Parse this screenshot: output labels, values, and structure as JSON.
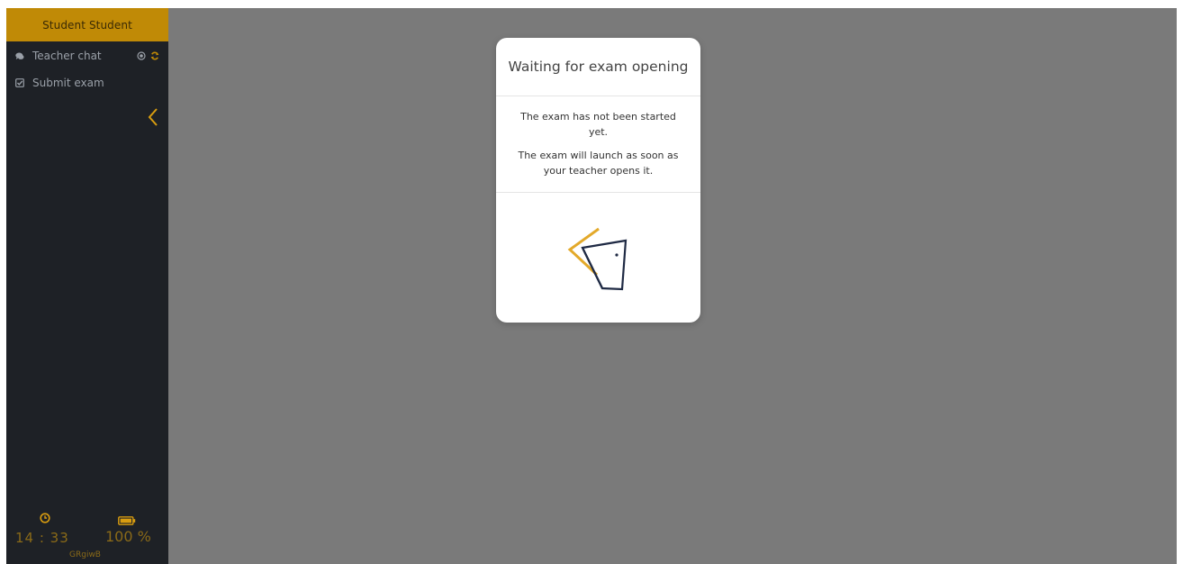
{
  "sidebar": {
    "user_name": "Student Student",
    "items": [
      {
        "label": "Teacher chat",
        "icon": "chat-icon"
      },
      {
        "label": "Submit exam",
        "icon": "checkbox-icon"
      }
    ],
    "footer": {
      "time": "14 : 33",
      "battery": "100 %",
      "code": "GRgiwB"
    }
  },
  "modal": {
    "title": "Waiting for exam opening",
    "line1": "The exam has not been started yet.",
    "line2": "The exam will launch as soon as your teacher opens it.",
    "graphic": "door-icon"
  },
  "colors": {
    "accent": "#c08a06",
    "sidebar_bg": "#1e2126",
    "overlay_bg": "#7a7a7a",
    "door_dark": "#1f2a44",
    "door_yellow": "#e3a92a"
  }
}
